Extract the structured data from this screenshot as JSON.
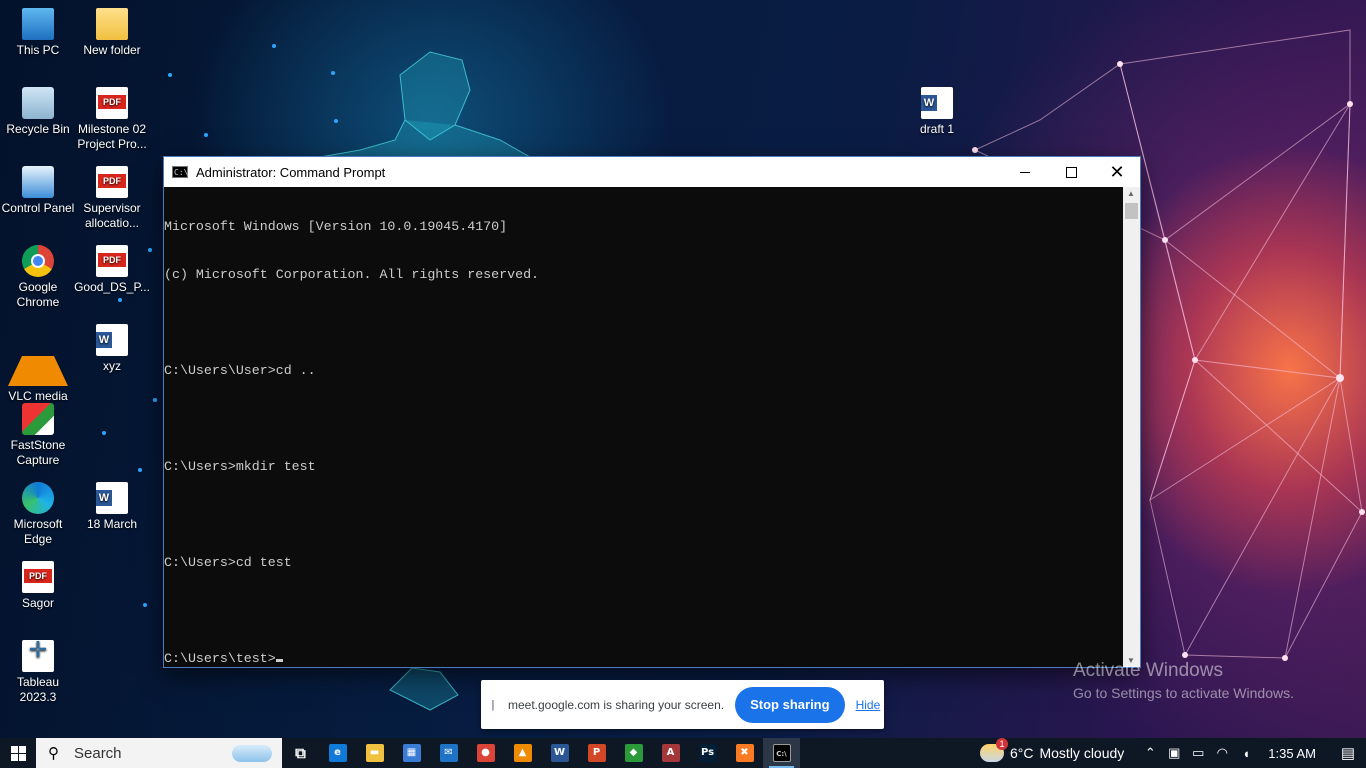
{
  "desktop": {
    "icons": [
      {
        "label": "This PC",
        "icon": "this-pc-icon"
      },
      {
        "label": "New folder",
        "icon": "folder-icon"
      },
      {
        "label": "Recycle Bin",
        "icon": "recycle-bin-icon"
      },
      {
        "label": "Milestone 02 Project Pro...",
        "icon": "pdf-icon"
      },
      {
        "label": "Control Panel",
        "icon": "control-panel-icon"
      },
      {
        "label": "Supervisor allocatio...",
        "icon": "pdf-icon"
      },
      {
        "label": "Google Chrome",
        "icon": "chrome-icon"
      },
      {
        "label": "Good_DS_P...",
        "icon": "pdf-icon"
      },
      {
        "label": "VLC media player",
        "icon": "vlc-icon"
      },
      {
        "label": "xyz",
        "icon": "word-doc-icon"
      },
      {
        "label": "FastStone Capture",
        "icon": "faststone-icon"
      },
      {
        "label": "Microsoft Edge",
        "icon": "edge-icon"
      },
      {
        "label": "18 March",
        "icon": "word-doc-icon"
      },
      {
        "label": "Sagor",
        "icon": "pdf-icon"
      },
      {
        "label": "Tableau 2023.3",
        "icon": "tableau-icon"
      },
      {
        "label": "draft 1",
        "icon": "word-doc-icon"
      }
    ]
  },
  "cmd": {
    "title": "Administrator: Command Prompt",
    "lines": [
      "Microsoft Windows [Version 10.0.19045.4170]",
      "(c) Microsoft Corporation. All rights reserved.",
      "",
      "C:\\Users\\User>cd ..",
      "",
      "C:\\Users>mkdir test",
      "",
      "C:\\Users>cd test",
      "",
      "C:\\Users\\test>"
    ],
    "minimize_glyph": "",
    "close_glyph": "✕"
  },
  "watermark": {
    "title": "Activate Windows",
    "subtitle": "Go to Settings to activate Windows."
  },
  "share_bar": {
    "handle": "||",
    "message": "meet.google.com is sharing your screen.",
    "stop_label": "Stop sharing",
    "hide_label": "Hide"
  },
  "taskbar": {
    "search_placeholder": "Search",
    "search_glyph": "⚲",
    "apps": [
      {
        "name": "task-view",
        "glyph": "⧉",
        "bg": "transparent"
      },
      {
        "name": "edge",
        "glyph": "e",
        "bg": "#0f7ad8"
      },
      {
        "name": "file-explorer",
        "glyph": "▬",
        "bg": "#f0c040"
      },
      {
        "name": "microsoft-store",
        "glyph": "▦",
        "bg": "#3a7bd5"
      },
      {
        "name": "mail",
        "glyph": "✉",
        "bg": "#1e73c7"
      },
      {
        "name": "chrome",
        "glyph": "●",
        "bg": "#db4437"
      },
      {
        "name": "vlc",
        "glyph": "▲",
        "bg": "#f08a00"
      },
      {
        "name": "word",
        "glyph": "W",
        "bg": "#2b5797"
      },
      {
        "name": "powerpoint",
        "glyph": "P",
        "bg": "#d24726"
      },
      {
        "name": "faststone",
        "glyph": "◆",
        "bg": "#2b9a3a"
      },
      {
        "name": "access",
        "glyph": "A",
        "bg": "#a4373a"
      },
      {
        "name": "photoshop",
        "glyph": "Ps",
        "bg": "#001e36"
      },
      {
        "name": "xampp",
        "glyph": "✖",
        "bg": "#fb7a24"
      },
      {
        "name": "command-prompt",
        "glyph": "C:\\",
        "bg": "#000000",
        "active": true
      }
    ],
    "weather": {
      "badge": "1",
      "temp": "6°C",
      "condition": "Mostly cloudy"
    },
    "tray_glyphs": {
      "chevron": "⌃",
      "meet": "▣",
      "battery": "▭",
      "wifi": "◠",
      "volume": "◖"
    },
    "clock": "1:35 AM",
    "notification_glyph": "▤"
  }
}
